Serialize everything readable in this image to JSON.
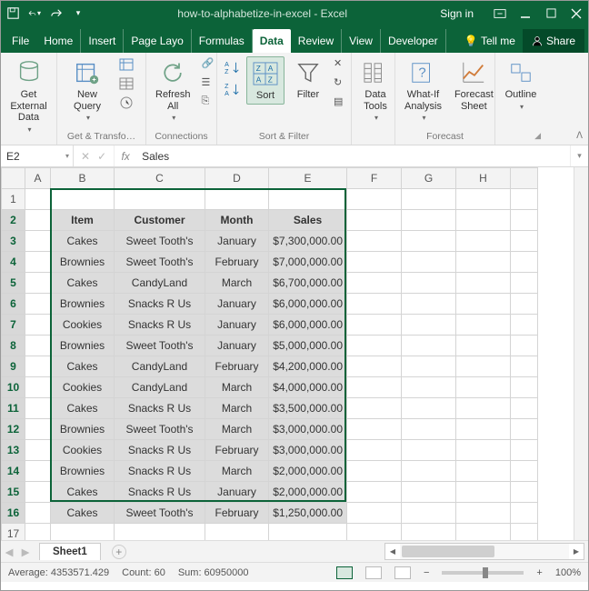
{
  "title": "how-to-alphabetize-in-excel - Excel",
  "sign_in": "Sign in",
  "file_tab": "File",
  "tabs": [
    "Home",
    "Insert",
    "Page Layo",
    "Formulas",
    "Data",
    "Review",
    "View",
    "Developer"
  ],
  "active_tab": "Data",
  "tell_me": "Tell me",
  "share": "Share",
  "ribbon": {
    "get_external": "Get External Data",
    "new_query": "New Query",
    "group1": "Get & Transfo…",
    "refresh_all": "Refresh All",
    "group2": "Connections",
    "sort_az": "A→Z",
    "sort_za": "Z→A",
    "sort": "Sort",
    "filter": "Filter",
    "group3": "Sort & Filter",
    "data_tools": "Data Tools",
    "whatif": "What-If Analysis",
    "forecast_sheet": "Forecast Sheet",
    "group4": "Forecast",
    "outline": "Outline"
  },
  "namebox": "E2",
  "formula": "Sales",
  "columns": [
    "A",
    "B",
    "C",
    "D",
    "E",
    "F",
    "G",
    "H"
  ],
  "headers": {
    "item": "Item",
    "customer": "Customer",
    "month": "Month",
    "sales": "Sales"
  },
  "rows": [
    {
      "item": "Cakes",
      "customer": "Sweet Tooth's",
      "month": "January",
      "sales": "$7,300,000.00"
    },
    {
      "item": "Brownies",
      "customer": "Sweet Tooth's",
      "month": "February",
      "sales": "$7,000,000.00"
    },
    {
      "item": "Cakes",
      "customer": "CandyLand",
      "month": "March",
      "sales": "$6,700,000.00"
    },
    {
      "item": "Brownies",
      "customer": "Snacks R Us",
      "month": "January",
      "sales": "$6,000,000.00"
    },
    {
      "item": "Cookies",
      "customer": "Snacks R Us",
      "month": "January",
      "sales": "$6,000,000.00"
    },
    {
      "item": "Brownies",
      "customer": "Sweet Tooth's",
      "month": "January",
      "sales": "$5,000,000.00"
    },
    {
      "item": "Cakes",
      "customer": "CandyLand",
      "month": "February",
      "sales": "$4,200,000.00"
    },
    {
      "item": "Cookies",
      "customer": "CandyLand",
      "month": "March",
      "sales": "$4,000,000.00"
    },
    {
      "item": "Cakes",
      "customer": "Snacks R Us",
      "month": "March",
      "sales": "$3,500,000.00"
    },
    {
      "item": "Brownies",
      "customer": "Sweet Tooth's",
      "month": "March",
      "sales": "$3,000,000.00"
    },
    {
      "item": "Cookies",
      "customer": "Snacks R Us",
      "month": "February",
      "sales": "$3,000,000.00"
    },
    {
      "item": "Brownies",
      "customer": "Snacks R Us",
      "month": "March",
      "sales": "$2,000,000.00"
    },
    {
      "item": "Cakes",
      "customer": "Snacks R Us",
      "month": "January",
      "sales": "$2,000,000.00"
    },
    {
      "item": "Cakes",
      "customer": "Sweet Tooth's",
      "month": "February",
      "sales": "$1,250,000.00"
    }
  ],
  "sheet_name": "Sheet1",
  "status": {
    "average": "Average: 4353571.429",
    "count": "Count: 60",
    "sum": "Sum: 60950000",
    "zoom": "100%"
  }
}
